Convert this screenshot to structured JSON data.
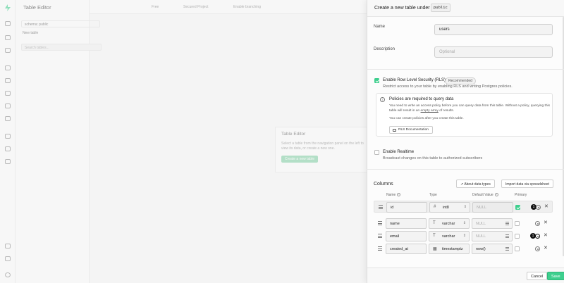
{
  "background": {
    "app_title": "Table Editor",
    "schema_label": "schema:",
    "schema_value": "public",
    "new_table_label": "New table",
    "search_placeholder": "Search tables...",
    "org_label": "Free",
    "project_label": "Secured Project",
    "branching_label": "Enable branching",
    "empty_title": "Table Editor",
    "empty_text": "Select a table from the navigation panel on the left to view its data, or create a new one.",
    "empty_button": "Create a new table"
  },
  "panel": {
    "title": "Create a new table under",
    "schema": "public",
    "name_label": "Name",
    "name_value": "users",
    "description_label": "Description",
    "description_placeholder": "Optional",
    "rls_label": "Enable Row Level Security (RLS)",
    "rls_badge": "Recommended",
    "rls_desc": "Restrict access to your table by enabling RLS and writing Postgres policies.",
    "info_title": "Policies are required to query data",
    "info_text_1": "You need to write an access policy before you can query data from this table. Without a policy, querying this table will result in an",
    "info_link": "empty array",
    "info_text_2": "of results.",
    "info_text_3": "You can create policies after you create this table.",
    "rls_docs_button": "RLS Documentation",
    "realtime_label": "Enable Realtime",
    "realtime_desc": "Broadcast changes on this table to authorized subscribers",
    "columns_title": "Columns",
    "about_types_button": "About data types",
    "import_button": "Import data via spreadsheet",
    "col_name_header": "Name",
    "col_type_header": "Type",
    "col_default_header": "Default Value",
    "col_primary_header": "Primary",
    "cancel_button": "Cancel",
    "save_button": "Save"
  },
  "columns": [
    {
      "name": "id",
      "type_icon": "#",
      "type": "int8",
      "default": "NULL",
      "primary": true,
      "badge": "1"
    },
    {
      "name": "name",
      "type_icon": "T",
      "type": "varchar",
      "default": "NULL",
      "primary": false,
      "badge": ""
    },
    {
      "name": "email",
      "type_icon": "T",
      "type": "varchar",
      "default": "NULL",
      "primary": false,
      "badge": "1"
    },
    {
      "name": "created_at",
      "type_icon": "calendar",
      "type": "timestamptz",
      "default": "now()",
      "primary": false,
      "badge": ""
    }
  ],
  "colors": {
    "accent": "#3ecf8e"
  }
}
